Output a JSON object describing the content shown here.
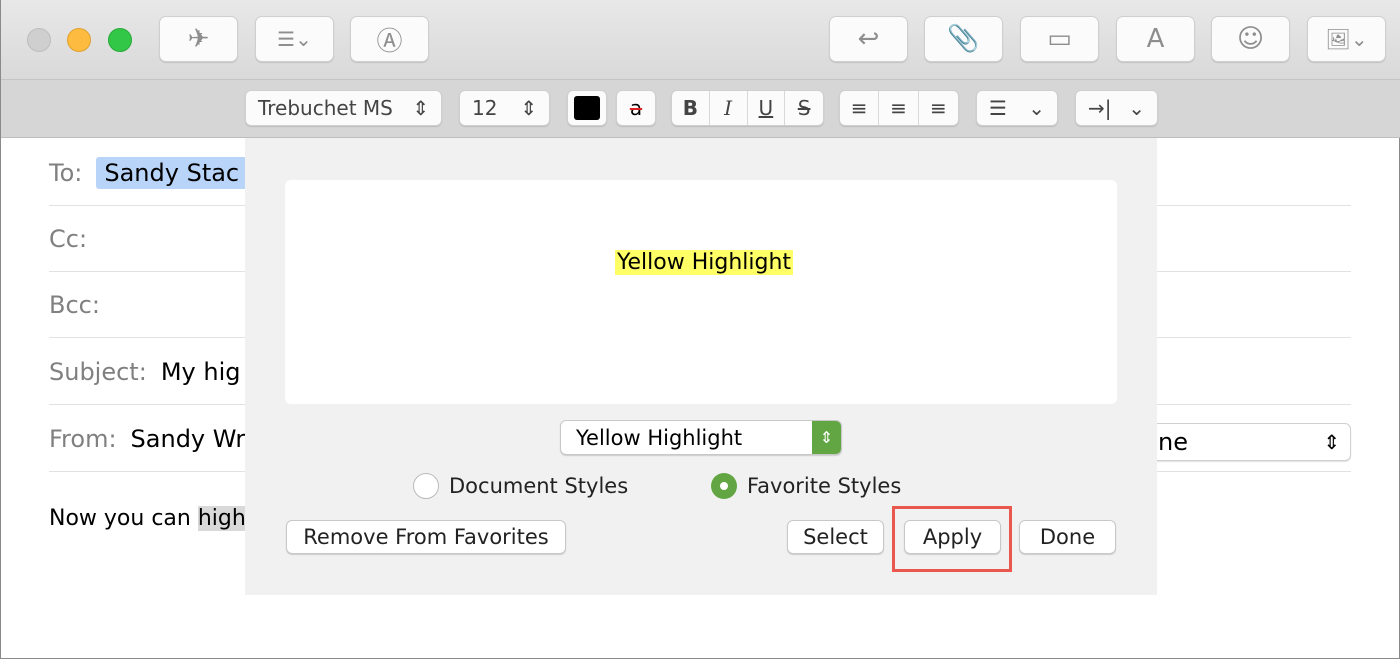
{
  "toolbar": {
    "icons": [
      "paper-plane-icon",
      "list-icon",
      "markup-icon",
      "reply-icon",
      "paperclip-icon",
      "attach-window-icon",
      "font-icon",
      "emoji-icon",
      "photo-icon"
    ],
    "font_letter": "A"
  },
  "format": {
    "font": "Trebuchet MS",
    "size": "12",
    "bold": "B",
    "italic": "I",
    "underline": "U",
    "strike": "S",
    "indent": "→|"
  },
  "headers": {
    "to_label": "To:",
    "to_value": "Sandy Stac",
    "cc_label": "Cc:",
    "bcc_label": "Bcc:",
    "subject_label": "Subject:",
    "subject_value": "My hig",
    "from_label": "From:",
    "from_value": "Sandy Wr",
    "signature_value": "ne"
  },
  "body": {
    "text": "Now you can ",
    "highlighted": "highl"
  },
  "panel": {
    "preview_text": "Yellow Highlight",
    "style_select": "Yellow Highlight",
    "radio_document": "Document Styles",
    "radio_favorite": "Favorite Styles",
    "selected_radio": "Favorite Styles",
    "remove": "Remove From Favorites",
    "select": "Select",
    "apply": "Apply",
    "done": "Done"
  },
  "colors": {
    "highlight": "#ffff66",
    "accent_green": "#62a543",
    "callout": "#e9574e"
  }
}
